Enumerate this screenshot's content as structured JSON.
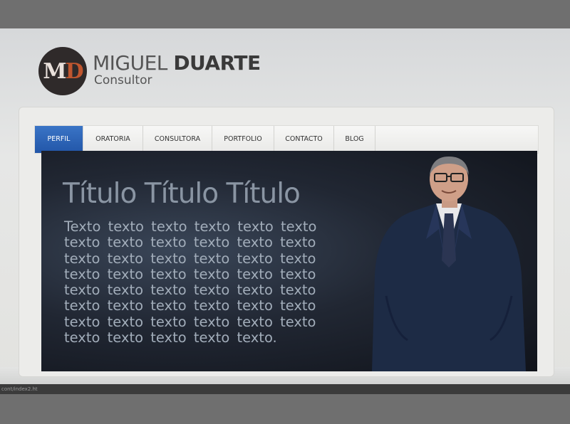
{
  "brand": {
    "logo_letters": "MD",
    "name_first": "MIGUEL",
    "name_last": "DUARTE",
    "subtitle": "Consultor"
  },
  "nav": {
    "items": [
      {
        "label": "PERFIL",
        "active": true
      },
      {
        "label": "ORATORIA",
        "active": false
      },
      {
        "label": "CONSULTORA",
        "active": false
      },
      {
        "label": "PORTFOLIO",
        "active": false
      },
      {
        "label": "CONTACTO",
        "active": false
      },
      {
        "label": "BLOG",
        "active": false
      }
    ]
  },
  "hero": {
    "title": "Título Título Título",
    "body": "Texto texto texto texto texto texto texto texto texto texto texto texto texto texto texto texto texto texto texto texto texto texto texto texto texto texto texto texto texto texto texto texto texto texto texto texto texto texto texto texto texto texto texto texto texto texto texto.",
    "photo_icon": "man-in-suit-portrait"
  },
  "status": {
    "text": "cont/index2.ht"
  },
  "colors": {
    "accent": "#2a5fb0",
    "logo_orange": "#c0562f",
    "hero_bg": "#1a1f29"
  }
}
